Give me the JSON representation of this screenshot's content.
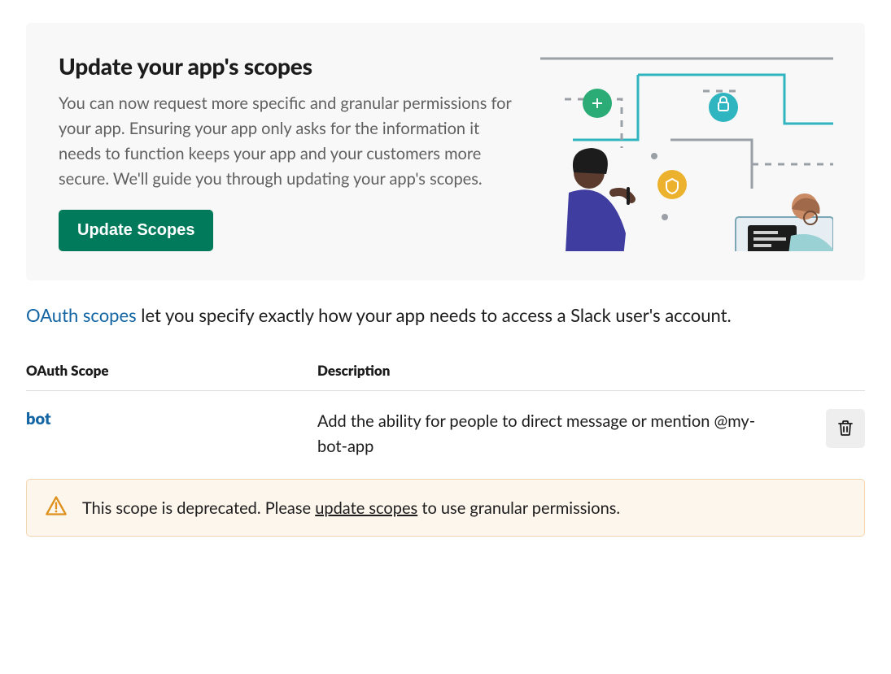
{
  "banner": {
    "title": "Update your app's scopes",
    "body": "You can now request more specific and granular permissions for your app. Ensuring your app only asks for the information it needs to function keeps your app and your customers more secure. We'll guide you through updating your app's scopes.",
    "cta": "Update Scopes"
  },
  "intro": {
    "link_text": "OAuth scopes",
    "rest": " let you specify exactly how your app needs to access a Slack user's account."
  },
  "table": {
    "col_scope": "OAuth Scope",
    "col_description": "Description",
    "rows": [
      {
        "scope": "bot",
        "description": "Add the ability for people to direct message or mention @my-bot-app"
      }
    ]
  },
  "deprecation": {
    "pre": "This scope is deprecated. Please ",
    "link": "update scopes",
    "post": " to use granular permissions."
  },
  "icons": {
    "trash": "trash-icon",
    "warn": "warning-icon"
  },
  "colors": {
    "primary_button": "#007a5a",
    "link": "#1264a3",
    "warn_bg": "#fdf6ed",
    "warn_border": "#f3d6af",
    "warn_fg": "#de911d"
  }
}
